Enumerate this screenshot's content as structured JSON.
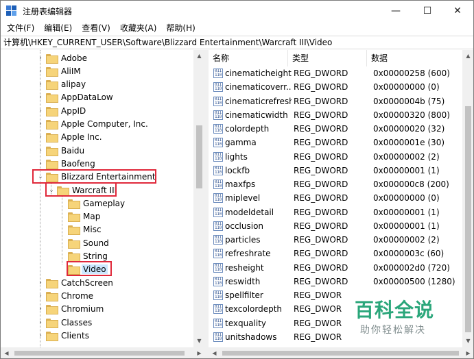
{
  "window": {
    "title": "注册表编辑器",
    "minimize_glyph": "—",
    "maximize_glyph": "☐",
    "close_glyph": "✕"
  },
  "menu": [
    "文件(F)",
    "编辑(E)",
    "查看(V)",
    "收藏夹(A)",
    "帮助(H)"
  ],
  "address": "计算机\\HKEY_CURRENT_USER\\Software\\Blizzard Entertainment\\Warcraft III\\Video",
  "tree": {
    "items": [
      {
        "label": "Adobe",
        "level": 0,
        "expander": "›"
      },
      {
        "label": "AliIM",
        "level": 0,
        "expander": "›"
      },
      {
        "label": "alipay",
        "level": 0,
        "expander": "›"
      },
      {
        "label": "AppDataLow",
        "level": 0,
        "expander": "›"
      },
      {
        "label": "AppID",
        "level": 0,
        "expander": "›"
      },
      {
        "label": "Apple Computer, Inc.",
        "level": 0,
        "expander": "›"
      },
      {
        "label": "Apple Inc.",
        "level": 0,
        "expander": "›"
      },
      {
        "label": "Baidu",
        "level": 0,
        "expander": "›"
      },
      {
        "label": "Baofeng",
        "level": 0,
        "expander": "›"
      },
      {
        "label": "Blizzard Entertainment",
        "level": 0,
        "expander": "⌄"
      },
      {
        "label": "Warcraft III",
        "level": 1,
        "expander": "⌄"
      },
      {
        "label": "Gameplay",
        "level": 2,
        "expander": ""
      },
      {
        "label": "Map",
        "level": 2,
        "expander": ""
      },
      {
        "label": "Misc",
        "level": 2,
        "expander": ""
      },
      {
        "label": "Sound",
        "level": 2,
        "expander": ""
      },
      {
        "label": "String",
        "level": 2,
        "expander": ""
      },
      {
        "label": "Video",
        "level": 2,
        "expander": "",
        "selected": true
      },
      {
        "label": "CatchScreen",
        "level": 0,
        "expander": "›"
      },
      {
        "label": "Chrome",
        "level": 0,
        "expander": "›"
      },
      {
        "label": "Chromium",
        "level": 0,
        "expander": "›"
      },
      {
        "label": "Classes",
        "level": 0,
        "expander": "›"
      },
      {
        "label": "Clients",
        "level": 0,
        "expander": "›"
      }
    ]
  },
  "list": {
    "headers": {
      "name": "名称",
      "type": "类型",
      "data": "数据"
    },
    "rows": [
      {
        "name": "cinematicheight",
        "type": "REG_DWORD",
        "data": "0x00000258 (600)"
      },
      {
        "name": "cinematicoverr...",
        "type": "REG_DWORD",
        "data": "0x00000000 (0)"
      },
      {
        "name": "cinematicrefresh",
        "type": "REG_DWORD",
        "data": "0x0000004b (75)"
      },
      {
        "name": "cinematicwidth",
        "type": "REG_DWORD",
        "data": "0x00000320 (800)"
      },
      {
        "name": "colordepth",
        "type": "REG_DWORD",
        "data": "0x00000020 (32)"
      },
      {
        "name": "gamma",
        "type": "REG_DWORD",
        "data": "0x0000001e (30)"
      },
      {
        "name": "lights",
        "type": "REG_DWORD",
        "data": "0x00000002 (2)"
      },
      {
        "name": "lockfb",
        "type": "REG_DWORD",
        "data": "0x00000001 (1)"
      },
      {
        "name": "maxfps",
        "type": "REG_DWORD",
        "data": "0x000000c8 (200)"
      },
      {
        "name": "miplevel",
        "type": "REG_DWORD",
        "data": "0x00000000 (0)"
      },
      {
        "name": "modeldetail",
        "type": "REG_DWORD",
        "data": "0x00000001 (1)"
      },
      {
        "name": "occlusion",
        "type": "REG_DWORD",
        "data": "0x00000001 (1)"
      },
      {
        "name": "particles",
        "type": "REG_DWORD",
        "data": "0x00000002 (2)"
      },
      {
        "name": "refreshrate",
        "type": "REG_DWORD",
        "data": "0x0000003c (60)"
      },
      {
        "name": "resheight",
        "type": "REG_DWORD",
        "data": "0x000002d0 (720)"
      },
      {
        "name": "reswidth",
        "type": "REG_DWORD",
        "data": "0x00000500 (1280)"
      },
      {
        "name": "spellfilter",
        "type": "REG_DWOR",
        "data": ""
      },
      {
        "name": "texcolordepth",
        "type": "REG_DWOR",
        "data": ""
      },
      {
        "name": "texquality",
        "type": "REG_DWOR",
        "data": ""
      },
      {
        "name": "unitshadows",
        "type": "REG_DWOR",
        "data": ""
      }
    ]
  },
  "value_icon_text": "011\n110",
  "watermark": {
    "main": "百科全说",
    "sub": "助你轻松解决"
  },
  "colors": {
    "selection": "#cce8ff",
    "highlight_box": "#e0283a",
    "watermark_green": "#2aa67a"
  }
}
